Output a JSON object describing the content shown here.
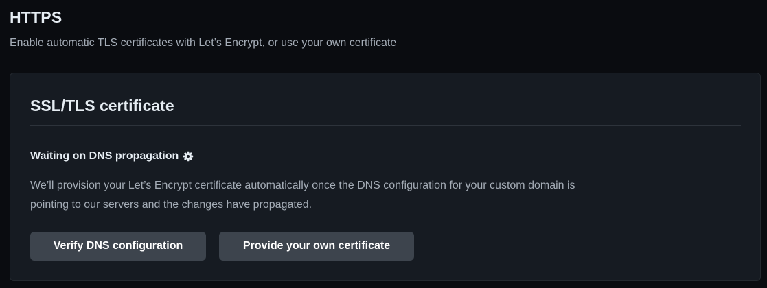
{
  "section": {
    "title": "HTTPS",
    "description": "Enable automatic TLS certificates with Let’s Encrypt, or use your own certificate"
  },
  "card": {
    "title": "SSL/TLS certificate",
    "status": {
      "label": "Waiting on DNS propagation",
      "icon": "gear-icon",
      "description": "We’ll provision your Let’s Encrypt certificate automatically once the DNS configuration for your custom domain is pointing to our servers and the changes have propagated."
    },
    "buttons": {
      "verify_label": "Verify DNS configuration",
      "own_cert_label": "Provide your own certificate"
    }
  },
  "colors": {
    "background": "#0a0c10",
    "card_background": "#161b22",
    "button_background": "#3d444d",
    "text_primary": "#e6edf3",
    "text_muted": "#a4acb6"
  }
}
